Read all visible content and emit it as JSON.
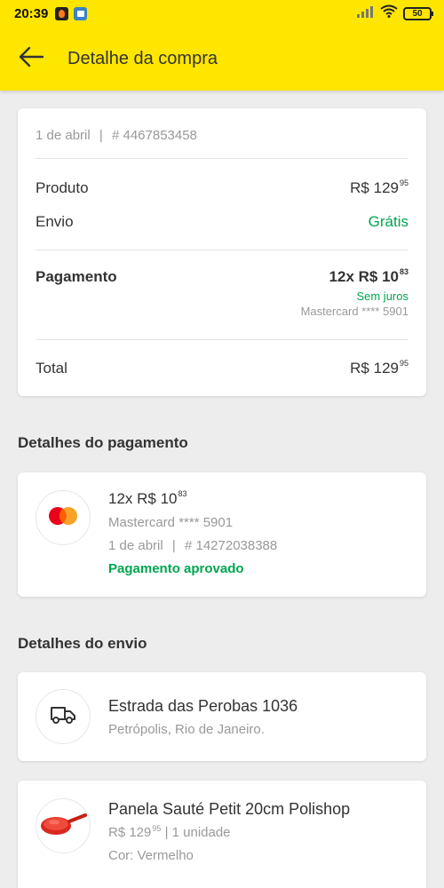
{
  "status_bar": {
    "time": "20:39",
    "battery": "50"
  },
  "header": {
    "title": "Detalhe da compra"
  },
  "summary": {
    "date": "1 de abril",
    "separator": "|",
    "order_id": "# 4467853458",
    "product_label": "Produto",
    "product_value": "R$ 129",
    "product_cents": "95",
    "shipping_label": "Envio",
    "shipping_value": "Grátis",
    "payment_label": "Pagamento",
    "payment_value": "12x R$ 10",
    "payment_cents": "83",
    "payment_interest": "Sem juros",
    "payment_card": "Mastercard **** 5901",
    "total_label": "Total",
    "total_value": "R$ 129",
    "total_cents": "95"
  },
  "payment_details": {
    "section_title": "Detalhes do pagamento",
    "installments": "12x R$ 10",
    "installments_cents": "83",
    "card": "Mastercard **** 5901",
    "date": "1 de abril",
    "separator": "|",
    "transaction_id": "# 14272038388",
    "status": "Pagamento aprovado"
  },
  "shipping_details": {
    "section_title": "Detalhes do envio",
    "address": "Estrada das Perobas 1036",
    "city": "Petrópolis, Rio de Janeiro."
  },
  "item": {
    "name": "Panela Sauté Petit 20cm Polishop",
    "price": "R$ 129",
    "price_cents": "95",
    "quantity": "| 1 unidade",
    "color": "Cor: Vermelho"
  },
  "colors": {
    "brand_yellow": "#ffe600",
    "success_green": "#00a650",
    "mastercard_red": "#eb001b",
    "mastercard_orange": "#f79e1b"
  },
  "icons": {
    "back": "arrow-left-icon",
    "payment": "mastercard-icon",
    "shipping": "truck-icon",
    "product": "frying-pan-icon"
  }
}
